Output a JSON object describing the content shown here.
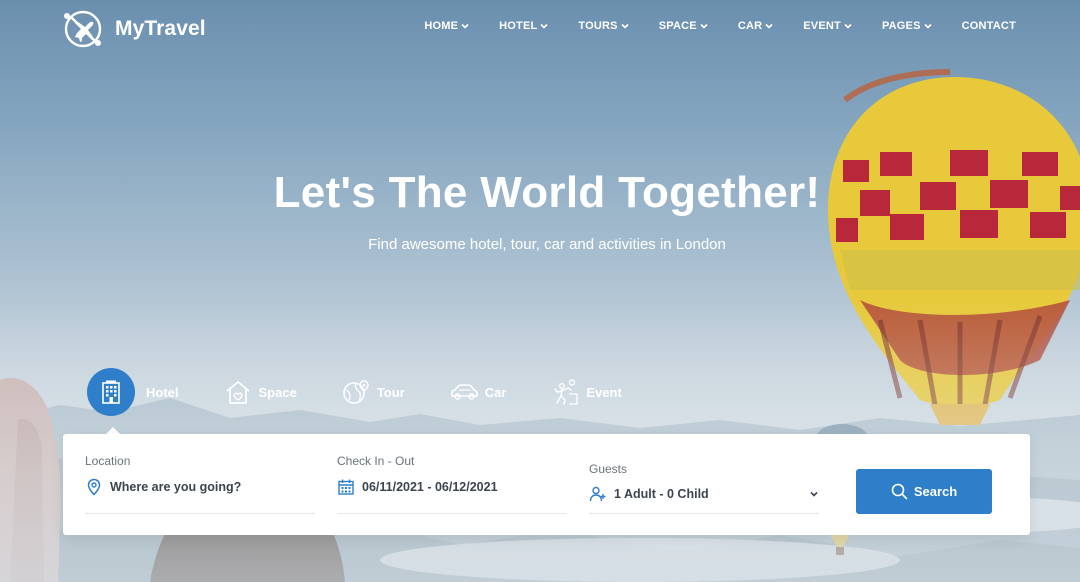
{
  "brand": {
    "name": "MyTravel"
  },
  "nav": {
    "items": [
      {
        "label": "HOME",
        "has_dropdown": true
      },
      {
        "label": "HOTEL",
        "has_dropdown": true
      },
      {
        "label": "TOURS",
        "has_dropdown": true
      },
      {
        "label": "SPACE",
        "has_dropdown": true
      },
      {
        "label": "CAR",
        "has_dropdown": true
      },
      {
        "label": "EVENT",
        "has_dropdown": true
      },
      {
        "label": "PAGES",
        "has_dropdown": true
      },
      {
        "label": "CONTACT",
        "has_dropdown": false
      }
    ]
  },
  "hero": {
    "title": "Let's The World Together!",
    "subtitle": "Find awesome hotel, tour, car and activities in London"
  },
  "tabs": [
    {
      "label": "Hotel",
      "icon": "hotel-building-icon",
      "active": true
    },
    {
      "label": "Space",
      "icon": "home-heart-icon",
      "active": false
    },
    {
      "label": "Tour",
      "icon": "globe-pin-icon",
      "active": false
    },
    {
      "label": "Car",
      "icon": "car-icon",
      "active": false
    },
    {
      "label": "Event",
      "icon": "climbing-person-icon",
      "active": false
    }
  ],
  "search": {
    "location": {
      "label": "Location",
      "placeholder": "Where are you going?",
      "icon": "map-pin-icon"
    },
    "dates": {
      "label": "Check In - Out",
      "value": "06/11/2021 - 06/12/2021",
      "icon": "calendar-icon"
    },
    "guests": {
      "label": "Guests",
      "value": "1 Adult - 0 Child",
      "icon": "users-add-icon"
    },
    "button_label": "Search"
  },
  "colors": {
    "accent": "#2f7ec9",
    "text_dark": "#3b444f",
    "label_grey": "#67747c"
  }
}
